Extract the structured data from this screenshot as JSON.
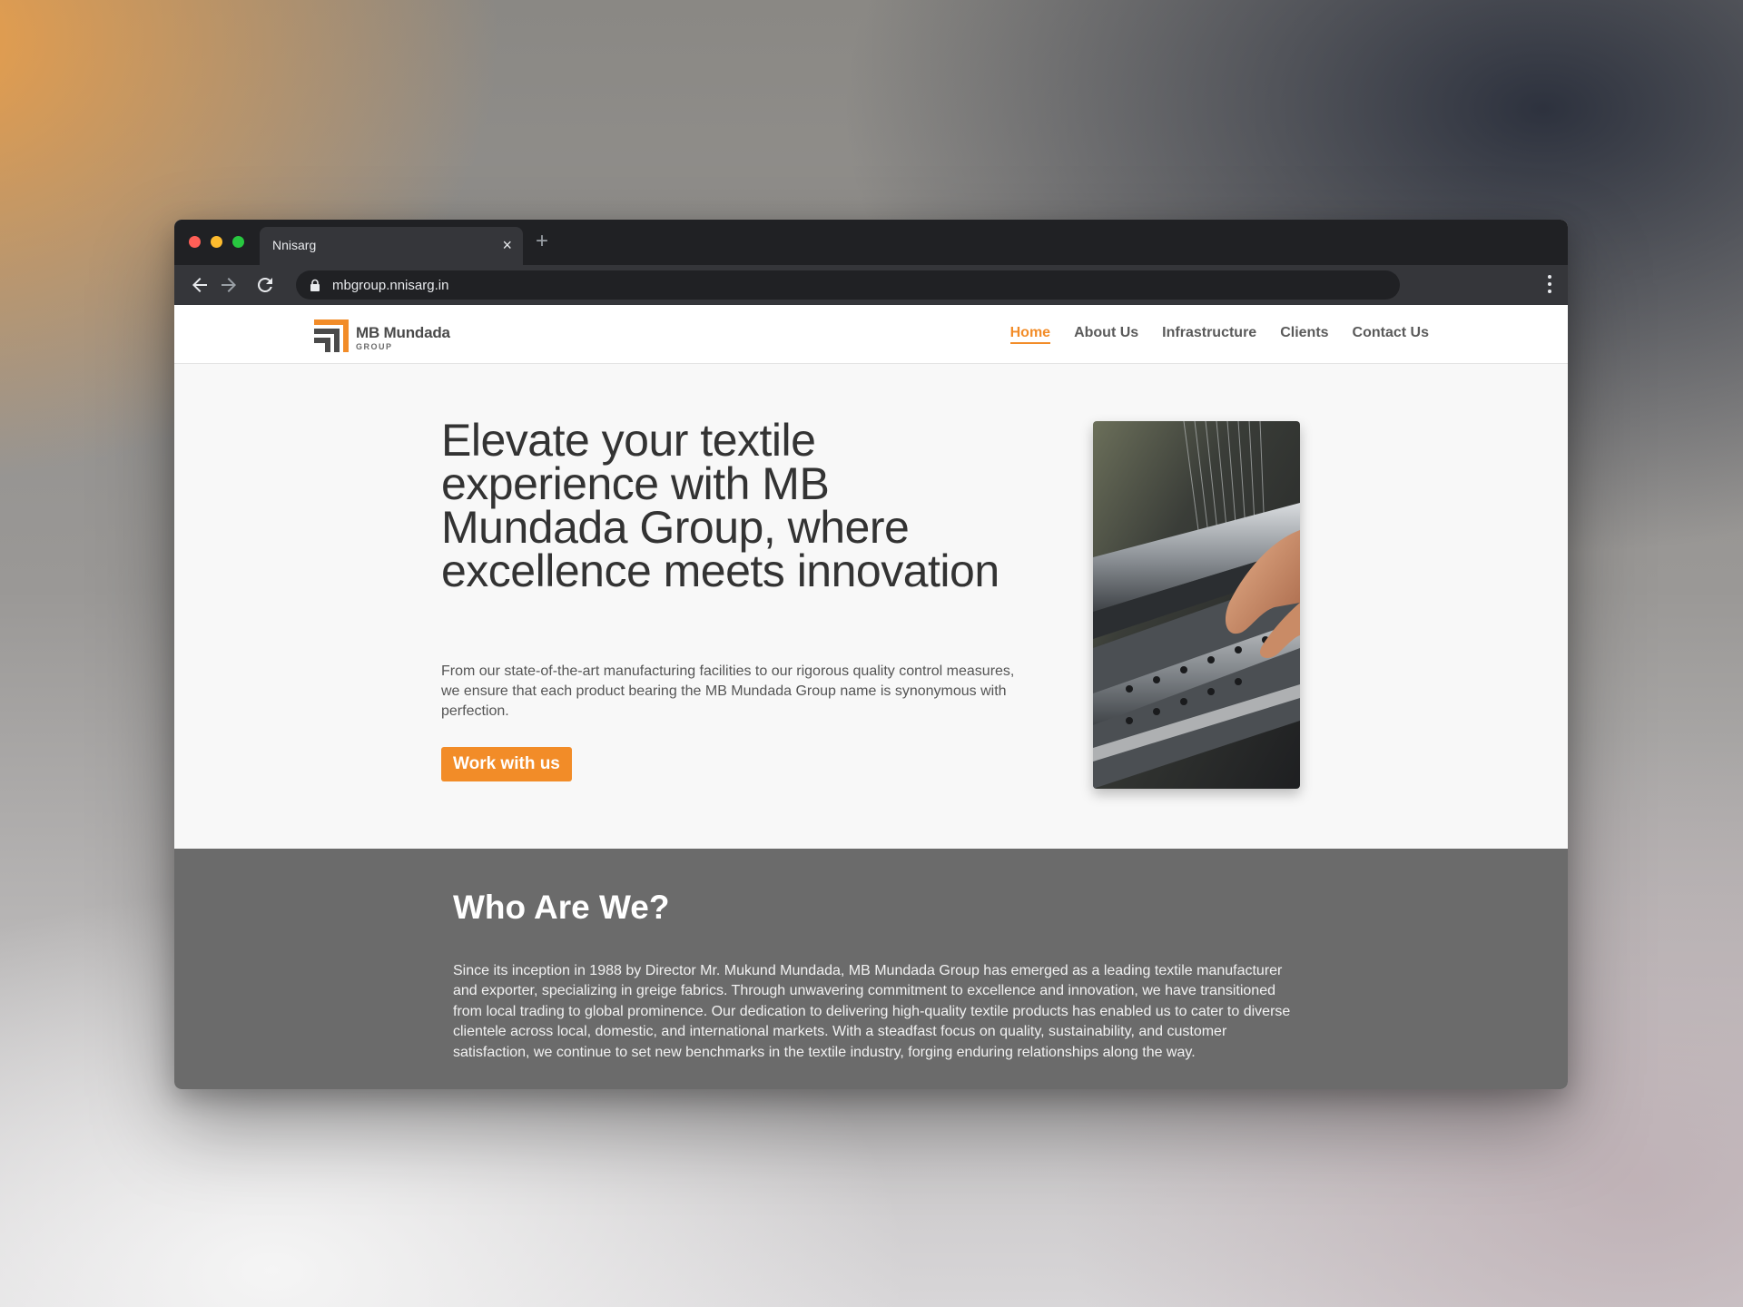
{
  "browser": {
    "tab_title": "Nnisarg",
    "url": "mbgroup.nnisarg.in",
    "new_tab_symbol": "+",
    "close_symbol": "×"
  },
  "site": {
    "logo": {
      "name": "MB Mundada",
      "subtitle": "GROUP"
    },
    "nav": [
      {
        "label": "Home",
        "active": true
      },
      {
        "label": "About Us",
        "active": false
      },
      {
        "label": "Infrastructure",
        "active": false
      },
      {
        "label": "Clients",
        "active": false
      },
      {
        "label": "Contact Us",
        "active": false
      }
    ],
    "hero": {
      "title": "Elevate your textile experience with MB Mundada Group, where excellence meets innovation",
      "description": "From our state-of-the-art manufacturing facilities to our rigorous quality control measures, we ensure that each product bearing the MB Mundada Group name is synonymous with perfection.",
      "cta_label": "Work with us"
    },
    "about": {
      "title": "Who Are We?",
      "text": "Since its inception in 1988 by Director Mr. Mukund Mundada, MB Mundada Group has emerged as a leading textile manufacturer and exporter, specializing in greige fabrics. Through unwavering commitment to excellence and innovation, we have transitioned from local trading to global prominence. Our dedication to delivering high-quality textile products has enabled us to cater to diverse clientele across local, domestic, and international markets. With a steadfast focus on quality, sustainability, and customer satisfaction, we continue to set new benchmarks in the textile industry, forging enduring relationships along the way."
    }
  },
  "colors": {
    "accent": "#f28c28",
    "about_background": "#6b6b6b",
    "heading_text": "#333333",
    "browser_chrome": "#202124"
  },
  "icons": [
    "back-arrow-icon",
    "forward-arrow-icon",
    "reload-icon",
    "lock-icon",
    "menu-dots-icon",
    "close-icon",
    "plus-icon"
  ]
}
